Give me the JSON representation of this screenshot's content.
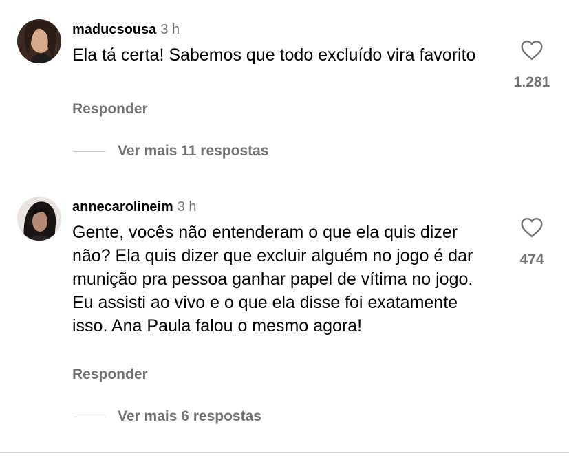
{
  "comments": [
    {
      "username": "maducsousa",
      "time": "3 h",
      "text": "Ela tá certa! Sabemos que todo excluído vira favorito",
      "likes": "1.281",
      "reply_label": "Responder",
      "more_replies_label": "Ver mais 11 respostas",
      "avatar_icon": "user-avatar-photo"
    },
    {
      "username": "annecarolineim",
      "time": "3 h",
      "text": "Gente, vocês não entenderam o que ela quis dizer não? Ela quis dizer que excluir alguém no jogo é dar munição pra pessoa ganhar papel de vítima no jogo. Eu assisti ao vivo e o que ela disse foi exatamente isso. Ana Paula falou o mesmo agora!",
      "likes": "474",
      "reply_label": "Responder",
      "more_replies_label": "Ver mais 6 respostas",
      "avatar_icon": "user-avatar-photo"
    }
  ],
  "icons": {
    "like": "heart-outline-icon"
  },
  "colors": {
    "text": "#000000",
    "secondary": "#737373",
    "divider": "#c7c7c7",
    "background": "#ffffff"
  }
}
